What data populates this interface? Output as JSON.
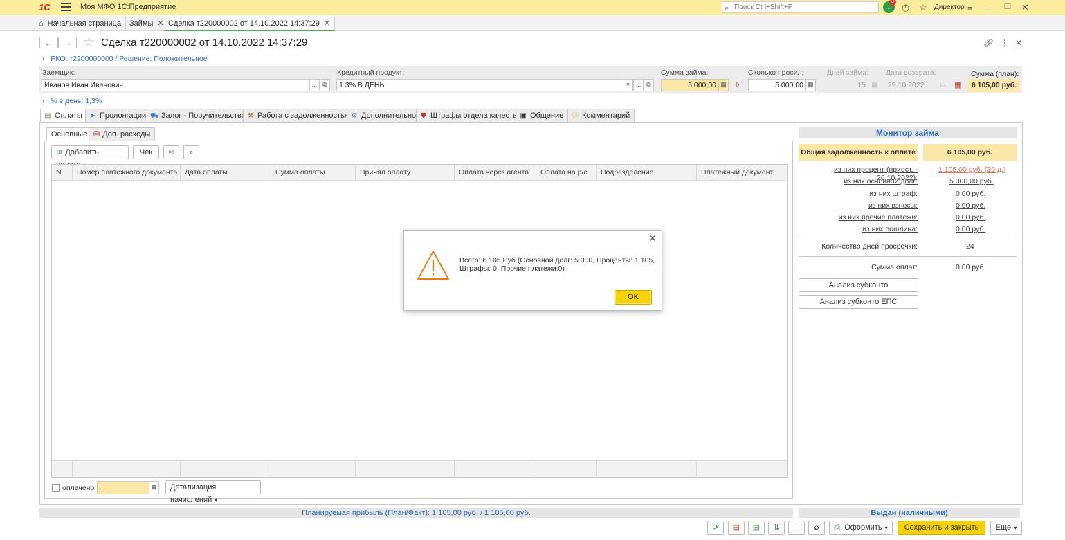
{
  "topbar": {
    "logo": "1С",
    "app_title": "Моя МФО 1С:Предприятие",
    "search_placeholder": "Поиск Ctrl+Shift+F",
    "notify_count": "3",
    "user": "Директор"
  },
  "window_tabs": [
    {
      "label": "Начальная страница"
    },
    {
      "label": "Займы"
    },
    {
      "label": "Сделка т220000002 от 14.10.2022 14:37:29"
    }
  ],
  "header": {
    "title": "Сделка т220000002 от 14.10.2022 14:37:29",
    "breadcrumb": "РКО: т2200000000 / Решение: Положительное",
    "percent_link": "% в день: 1,3%"
  },
  "fields": {
    "borrower_label": "Заемщик:",
    "borrower_value": "Иванов Иван Иванович",
    "product_label": "Кредитный продукт:",
    "product_value": "1.3%  В ДЕНЬ",
    "loan_sum_label": "Сумма займа:",
    "loan_sum_value": "5 000,00",
    "requested_label": "Сколько просил:",
    "requested_value": "5 000,00",
    "days_label": "Дней займа:",
    "days_value": "15",
    "return_date_label": "Дата возврата:",
    "return_date_value": "29.10.2022",
    "plan_sum_label": "Сумма (план):",
    "plan_sum_value": "6 105,00 руб."
  },
  "main_tabs": [
    {
      "label": "Оплаты"
    },
    {
      "label": "Пролонгации"
    },
    {
      "label": "Залог - Поручительство"
    },
    {
      "label": "Работа с задолженностью"
    },
    {
      "label": "Дополнительно"
    },
    {
      "label": "Штрафы отдела качества"
    },
    {
      "label": "Общение"
    },
    {
      "label": "Комментарий"
    }
  ],
  "sub_tabs": [
    {
      "label": "Основные"
    },
    {
      "label": "Доп. расходы"
    }
  ],
  "toolbar": {
    "add_payment": "Добавить оплату",
    "check": "Чек"
  },
  "grid": {
    "columns": [
      "N",
      "Номер платежного документа",
      "Дата оплаты",
      "Сумма оплаты",
      "Принял оплату",
      "Оплата через агента",
      "Оплата на р/с",
      "Подразделение",
      "Платежный документ"
    ]
  },
  "bottom_controls": {
    "paid_label": "оплачено",
    "date_placeholder": " .  .",
    "detail_button": "Детализация начислений"
  },
  "monitor": {
    "title": "Монитор займа",
    "total_label": "Общая задолженность к оплате",
    "total_value": "6 105,00 руб.",
    "rows": [
      {
        "label": "из них процент (приост. - 26.10.2022):",
        "value": "1 105,00 руб. (39 д.)"
      },
      {
        "label": "из них основной долг:",
        "value": "5 000,00 руб."
      },
      {
        "label": "из них штраф:",
        "value": "0,00 руб."
      },
      {
        "label": "из них взносы:",
        "value": "0,00 руб."
      },
      {
        "label": "из них прочие платежи:",
        "value": "0,00 руб."
      },
      {
        "label": "из них пошлина:",
        "value": "0,00 руб."
      }
    ],
    "overdue_label": "Количество дней просрочки:",
    "overdue_value": "24",
    "payments_label": "Сумма оплат:",
    "payments_value": "0,00 руб.",
    "btn_analysis": "Анализ субконто",
    "btn_analysis_eps": "Анализ субконто ЕПС"
  },
  "dialog": {
    "message": "Всего: 6 105 Руб.(Основной долг: 5 000, Проценты: 1 105, Штрафы: 0, Прочие платежи:0)",
    "ok": "OK"
  },
  "status": {
    "profit": "Планируемая прибыль (План/Факт): 1 105,00 руб. / 1 105,00 руб.",
    "issued": "Выдан (наличными)"
  },
  "footer": {
    "format": "Оформить",
    "save_close": "Сохранить и закрыть",
    "more": "Еще"
  },
  "colors": {
    "topbar": "#fbed9e",
    "accent_yellow": "#f6d300",
    "link_blue": "#2a6fb3",
    "warning_orange": "#e87e1e",
    "overdue_red": "#e06b5a"
  }
}
